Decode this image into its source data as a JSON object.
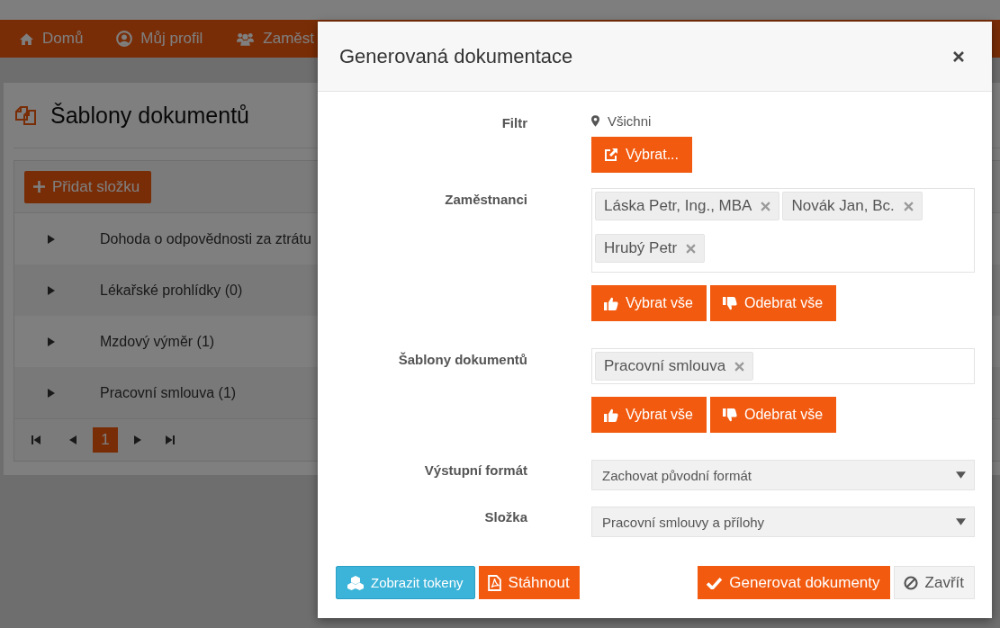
{
  "nav": {
    "items": [
      {
        "label": "Domů"
      },
      {
        "label": "Můj profil"
      },
      {
        "label": "Zaměst"
      }
    ]
  },
  "page": {
    "title": "Šablony dokumentů",
    "add_button": "Přidat složku",
    "rows": [
      {
        "label": "Dohoda o odpovědnosti za ztrátu"
      },
      {
        "label": "Lékařské prohlídky (0)"
      },
      {
        "label": "Mzdový výměr (1)"
      },
      {
        "label": "Pracovní smlouva (1)"
      }
    ],
    "pagination": {
      "pages": [
        {
          "label": "1",
          "selected": true
        }
      ]
    }
  },
  "modal": {
    "title": "Generovaná dokumentace",
    "fields": [
      {
        "kind": "location",
        "label": "Filtr",
        "value": "Všichni",
        "button": "Vybrat..."
      },
      {
        "kind": "tags",
        "label": "Zaměstnanci",
        "tags": [
          "Láska Petr, Ing., MBA",
          "Novák Jan, Bc.",
          "Hrubý Petr"
        ],
        "buttons": [
          "Vybrat vše",
          "Odebrat vše"
        ]
      },
      {
        "kind": "tags",
        "label": "Šablony dokumentů",
        "tags": [
          "Pracovní smlouva"
        ],
        "buttons": [
          "Vybrat vše",
          "Odebrat vše"
        ]
      },
      {
        "kind": "select",
        "label": "Výstupní formát",
        "value": "Zachovat původní formát"
      },
      {
        "kind": "select",
        "label": "Složka",
        "value": "Pracovní smlouvy a přílohy"
      }
    ],
    "footer_left": [
      {
        "kind": "tokens",
        "label": "Zobrazit tokeny"
      },
      {
        "kind": "pdf",
        "label": "Stáhnout"
      }
    ],
    "footer_right": [
      {
        "kind": "generate",
        "label": "Generovat dokumenty"
      },
      {
        "kind": "close",
        "label": "Zavřít"
      }
    ]
  }
}
